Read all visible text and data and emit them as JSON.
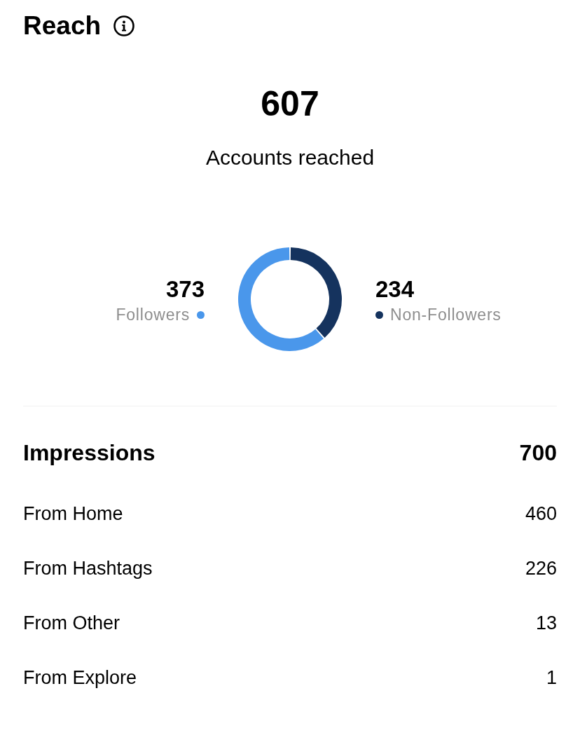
{
  "header": {
    "title": "Reach"
  },
  "summary": {
    "value": "607",
    "label": "Accounts reached"
  },
  "reach_split": {
    "chart_data": {
      "type": "donut",
      "categories": [
        "Followers",
        "Non-Followers"
      ],
      "values": [
        373,
        234
      ],
      "colors": [
        "#4a97eb",
        "#15335e"
      ],
      "data_labels": true
    }
  },
  "impressions": {
    "label": "Impressions",
    "value": "700",
    "rows": [
      {
        "label": "From Home",
        "value": "460"
      },
      {
        "label": "From Hashtags",
        "value": "226"
      },
      {
        "label": "From Other",
        "value": "13"
      },
      {
        "label": "From Explore",
        "value": "1"
      }
    ]
  }
}
